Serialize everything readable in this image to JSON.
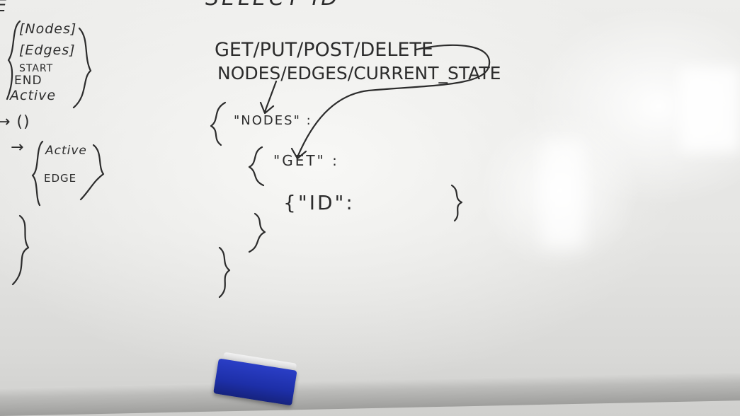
{
  "board": {
    "top_cut": "SELECT ID",
    "left_column": {
      "e": "E",
      "nodes": "[Nodes]",
      "edges": "[Edges]",
      "start": "START",
      "end": "END",
      "active": "Active",
      "arrow_parens": "→ ()",
      "arrow": "→",
      "active2": "Active",
      "edge": "EDGE"
    },
    "center": {
      "methods": "GET/PUT/POST/DELETE",
      "resources": "NODES/EDGES/CURRENT_STATE",
      "nodes_key": "\"NODES\" :",
      "get_key": "\"GET\" :",
      "id_key": "{\"ID\":"
    }
  },
  "colors": {
    "ink": "#2c2c2c",
    "eraser": "#1d2fa8"
  }
}
